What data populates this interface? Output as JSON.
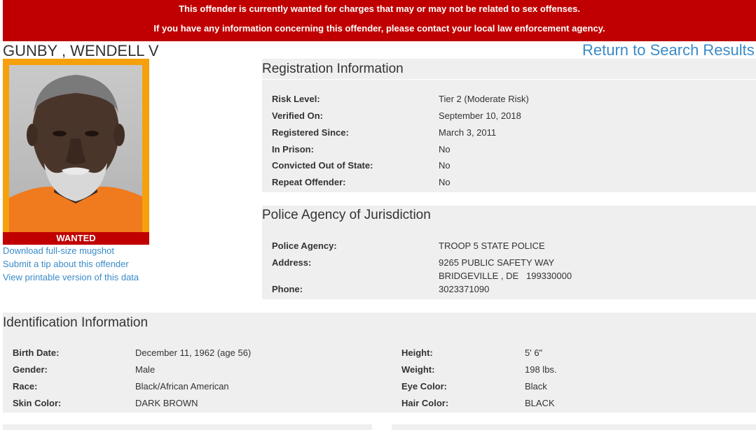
{
  "banner": {
    "line1": "This offender is currently wanted for charges that may or may not be related to sex offenses.",
    "line2": "If you have any information concerning this offender, please contact your local law enforcement agency."
  },
  "offender_name": "GUNBY , WENDELL V",
  "return_link": "Return to Search Results",
  "mugshot": {
    "badge": "WANTED"
  },
  "links": {
    "download": "Download full-size mugshot",
    "tip": "Submit a tip about this offender",
    "printable": "View printable version of this data"
  },
  "registration": {
    "title": "Registration Information",
    "rows": [
      {
        "label": "Risk Level:",
        "value": "Tier 2 (Moderate Risk)"
      },
      {
        "label": "Verified On:",
        "value": "September 10, 2018"
      },
      {
        "label": "Registered Since:",
        "value": "March 3, 2011"
      },
      {
        "label": "In Prison:",
        "value": "No"
      },
      {
        "label": "Convicted Out of State:",
        "value": "No"
      },
      {
        "label": "Repeat Offender:",
        "value": "No"
      }
    ]
  },
  "police": {
    "title": "Police Agency of Jurisdiction",
    "agency_label": "Police Agency:",
    "agency_value": "TROOP 5 STATE POLICE",
    "address_label": "Address:",
    "address_line1": "9265 PUBLIC SAFETY WAY",
    "address_line2": "BRIDGEVILLE , DE   199330000",
    "phone_label": "Phone:",
    "phone_value": "3023371090"
  },
  "identification": {
    "title": "Identification Information",
    "left": [
      {
        "label": "Birth Date:",
        "value": "December 11, 1962 (age 56)"
      },
      {
        "label": "Gender:",
        "value": "Male"
      },
      {
        "label": "Race:",
        "value": "Black/African American"
      },
      {
        "label": "Skin Color:",
        "value": "DARK BROWN"
      }
    ],
    "right": [
      {
        "label": "Height:",
        "value": "5' 6\""
      },
      {
        "label": "Weight:",
        "value": "198 lbs."
      },
      {
        "label": "Eye Color:",
        "value": "Black"
      },
      {
        "label": "Hair Color:",
        "value": "BLACK"
      }
    ]
  },
  "colors": {
    "alert_red": "#c00000",
    "link_blue": "#3a8bc8",
    "mugshot_frame": "#f5a00c",
    "panel_bg": "#efefef"
  }
}
